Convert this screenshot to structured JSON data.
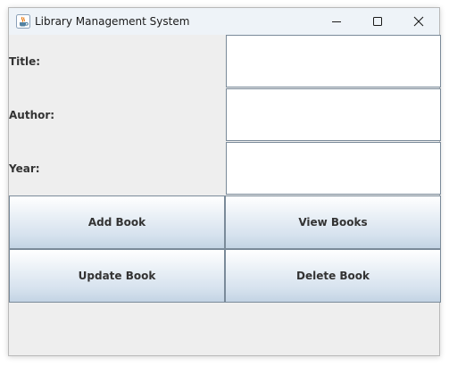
{
  "window": {
    "title": "Library Management System",
    "app_icon": "java-cup-icon",
    "controls": {
      "minimize_icon": "minimize-icon",
      "maximize_icon": "maximize-icon",
      "close_icon": "close-icon"
    }
  },
  "form": {
    "fields": [
      {
        "label": "Title:",
        "value": ""
      },
      {
        "label": "Author:",
        "value": ""
      },
      {
        "label": "Year:",
        "value": ""
      }
    ]
  },
  "buttons": {
    "add": "Add Book",
    "view": "View Books",
    "update": "Update Book",
    "delete": "Delete Book"
  },
  "colors": {
    "window_bg": "#eeeeee",
    "titlebar_bg": "#eef3f8",
    "button_gradient_top": "#ffffff",
    "button_gradient_bottom": "#c3d4e4",
    "border": "#7a8a99"
  }
}
